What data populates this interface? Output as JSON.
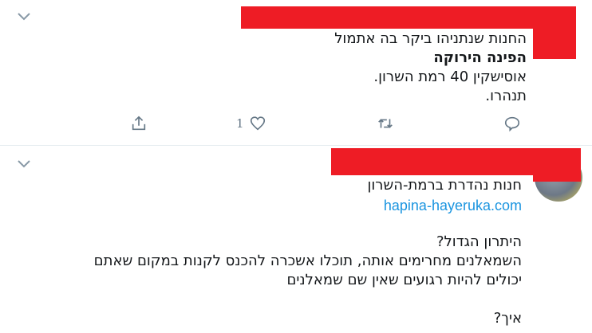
{
  "tweets": [
    {
      "lines": [
        "החנות שנתניהו ביקר בה אתמול",
        "הפינה הירוקה",
        "אוסישקין 40 רמת השרון.",
        "תנהרו."
      ],
      "actions": {
        "reply_icon": "reply-icon",
        "retweet_icon": "retweet-icon",
        "like_icon": "heart-icon",
        "like_count": "1",
        "share_icon": "share-icon"
      }
    },
    {
      "lines": [
        "חנות נהדרת ברמת-השרון"
      ],
      "link": "hapina-hayeruka.com",
      "body": [
        "היתרון הגדול?",
        "השמאלנים מחרימים אותה, תוכלו אשכרה להכנס לקנות במקום שאתם",
        "יכולים להיות רגועים שאין שם שמאלנים",
        "איך?"
      ]
    }
  ],
  "colors": {
    "redaction": "#ee1c25",
    "link": "#1b95e0",
    "icon": "#657786",
    "divider": "#e6ecf0"
  }
}
